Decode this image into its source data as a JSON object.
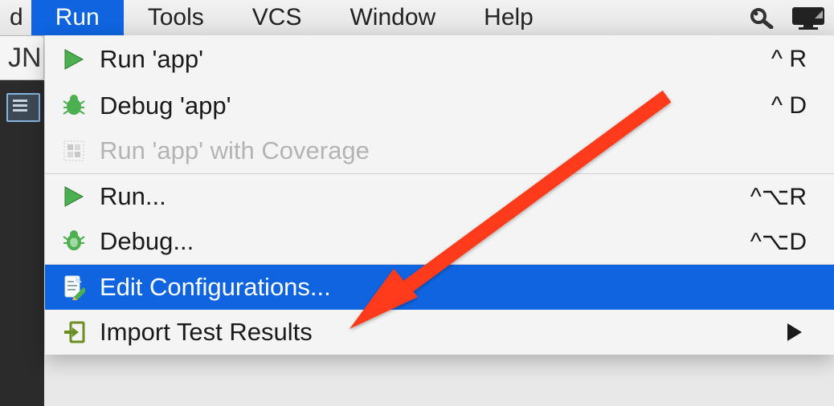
{
  "editor_peek": "JN",
  "menubar": {
    "partial_item": "d",
    "items": [
      "Run",
      "Tools",
      "VCS",
      "Window",
      "Help"
    ],
    "selected_index": 0
  },
  "dropdown": {
    "items": [
      {
        "label": "Run 'app'",
        "shortcut": "^ R",
        "icon": "play-icon",
        "disabled": false
      },
      {
        "label": "Debug 'app'",
        "shortcut": "^ D",
        "icon": "bug-icon",
        "disabled": false
      },
      {
        "label": "Run 'app' with Coverage",
        "shortcut": "",
        "icon": "coverage-icon",
        "disabled": true
      },
      {
        "label": "Run...",
        "shortcut": "^⌥R",
        "icon": "play-icon",
        "disabled": false,
        "separator_before": true
      },
      {
        "label": "Debug...",
        "shortcut": "^⌥D",
        "icon": "bug-green-icon",
        "disabled": false
      },
      {
        "label": "Edit Configurations...",
        "shortcut": "",
        "icon": "edit-config-icon",
        "disabled": false,
        "highlight": true,
        "separator_before": true
      },
      {
        "label": "Import Test Results",
        "shortcut": "submenu",
        "icon": "import-icon",
        "disabled": false
      }
    ]
  }
}
